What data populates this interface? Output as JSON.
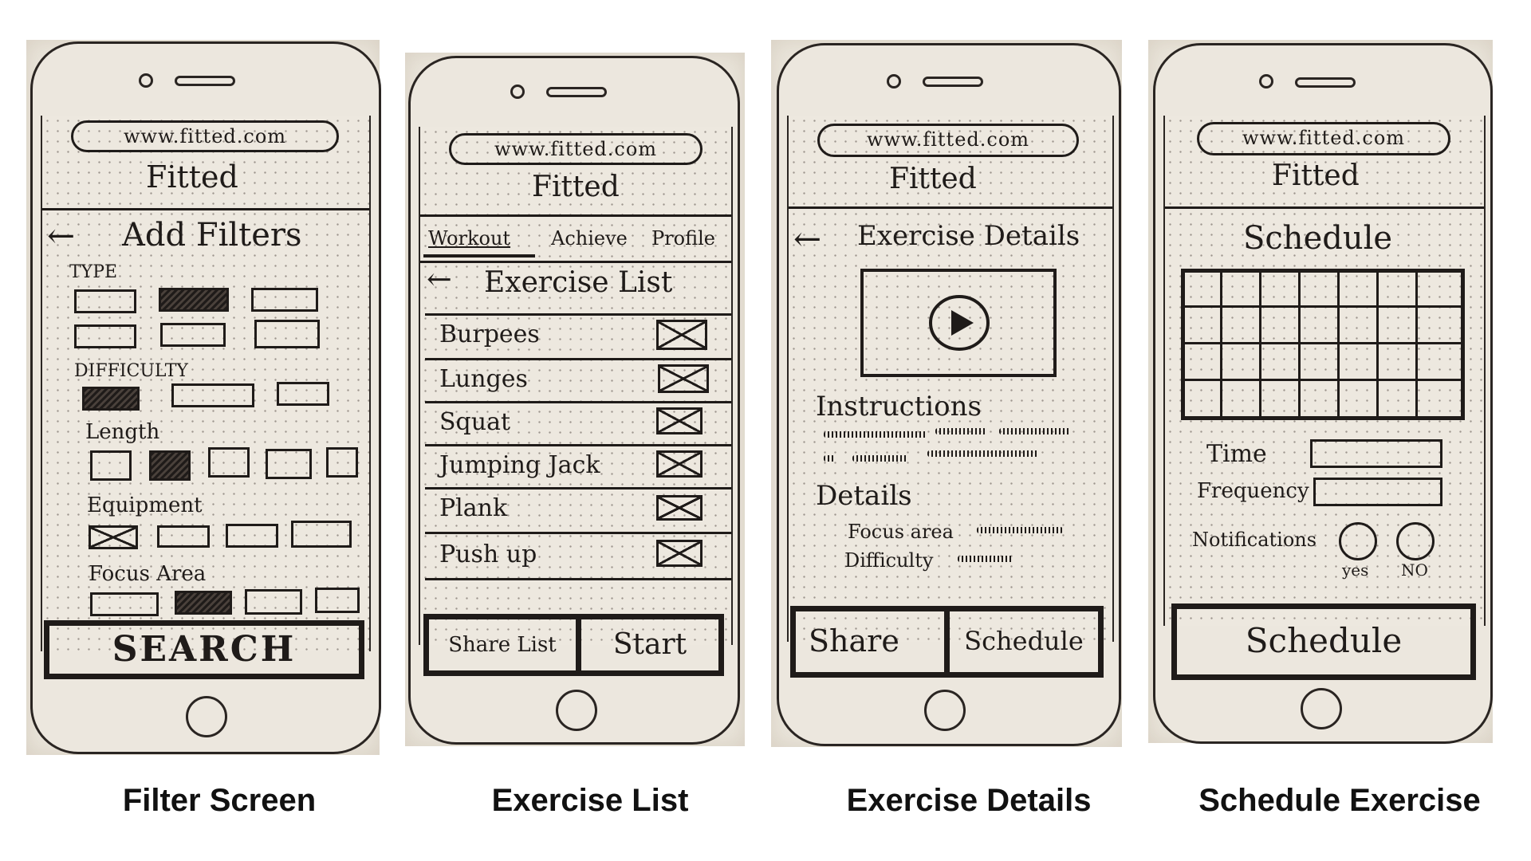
{
  "captions": [
    "Filter Screen",
    "Exercise List",
    "Exercise Details",
    "Schedule Exercise"
  ],
  "phones": [
    {
      "url": "www.fitted.com",
      "app_name": "Fitted",
      "back_arrow": "←",
      "title": "Add Filters",
      "sections": [
        "TYPE",
        "DIFFICULTY",
        "Length",
        "Equipment",
        "Focus Area"
      ],
      "button": "SEARCH"
    },
    {
      "url": "www.fitted.com",
      "app_name": "Fitted",
      "tabs": [
        "Workout",
        "Achieve",
        "Profile"
      ],
      "back_arrow": "←",
      "title": "Exercise List",
      "exercises": [
        "Burpees",
        "Lunges",
        "Squat",
        "Jumping Jack",
        "Plank",
        "Push up"
      ],
      "buttons": [
        "Share List",
        "Start"
      ]
    },
    {
      "url": "www.fitted.com",
      "app_name": "Fitted",
      "back_arrow": "←",
      "title": "Exercise Details",
      "instructions_label": "Instructions",
      "details_label": "Details",
      "detail_fields": [
        "Focus area",
        "Difficulty"
      ],
      "buttons": [
        "Share",
        "Schedule"
      ]
    },
    {
      "url": "www.fitted.com",
      "app_name": "Fitted",
      "title": "Schedule",
      "fields": [
        "Time",
        "Frequency"
      ],
      "notifications_label": "Notifications",
      "radio_options": [
        "yes",
        "NO"
      ],
      "button": "Schedule"
    }
  ],
  "icons": [
    "back-arrow-icon",
    "play-icon",
    "checkbox-x-icon",
    "camera-icon",
    "speaker-icon",
    "home-button-icon"
  ]
}
